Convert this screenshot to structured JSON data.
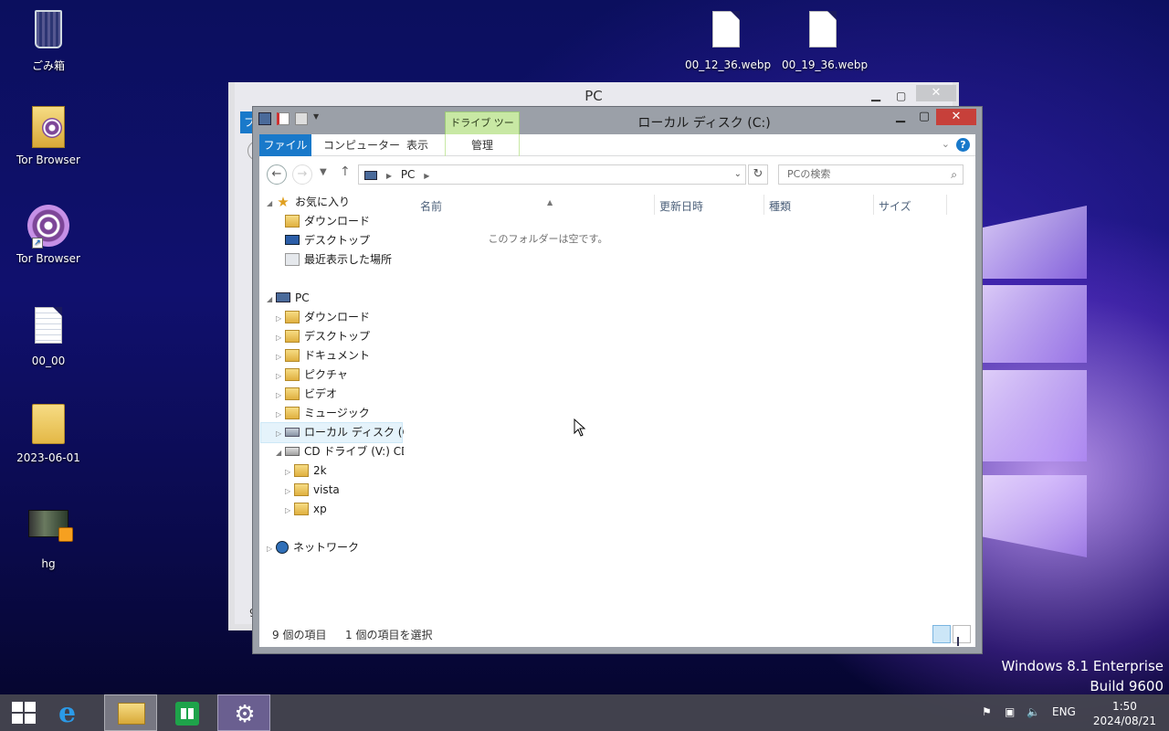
{
  "desktop": {
    "icons": [
      {
        "label": "ごみ箱"
      },
      {
        "label": "Tor Browser"
      },
      {
        "label": "Tor Browser"
      },
      {
        "label": "00_00"
      },
      {
        "label": "2023-06-01"
      },
      {
        "label": "hg"
      },
      {
        "label": "00_12_36.webp"
      },
      {
        "label": "00_19_36.webp"
      }
    ]
  },
  "bg_window": {
    "title": "PC",
    "partial_tab": "フ",
    "partial_status": "9"
  },
  "window": {
    "title": "ローカル ディスク (C:)",
    "tool_tab": "ドライブ ツール",
    "ribbon_tabs": {
      "file": "ファイル",
      "computer": "コンピューター",
      "view": "表示",
      "manage": "管理"
    },
    "address": {
      "crumb": "PC",
      "search_placeholder": "PCの検索"
    },
    "nav": {
      "favorites": "お気に入り",
      "fav_downloads": "ダウンロード",
      "fav_desktop": "デスクトップ",
      "fav_recent": "最近表示した場所",
      "pc": "PC",
      "pc_downloads": "ダウンロード",
      "pc_desktop": "デスクトップ",
      "pc_documents": "ドキュメント",
      "pc_pictures": "ピクチャ",
      "pc_videos": "ビデオ",
      "pc_music": "ミュージック",
      "local_disk": "ローカル ディスク (C:)",
      "cd_drive": "CD ドライブ (V:) CDF",
      "cd_2k": "2k",
      "cd_vista": "vista",
      "cd_xp": "xp",
      "network": "ネットワーク"
    },
    "columns": {
      "name": "名前",
      "modified": "更新日時",
      "type": "種類",
      "size": "サイズ"
    },
    "empty_message": "このフォルダーは空です。",
    "status": {
      "item_count": "9 個の項目",
      "selected": "1 個の項目を選択"
    }
  },
  "watermark": {
    "line1": "Windows 8.1 Enterprise",
    "line2": "Build 9600"
  },
  "taskbar": {
    "lang": "ENG",
    "time": "1:50",
    "date": "2024/08/21"
  },
  "colors": {
    "ribbon_file_tab": "#1979ca",
    "tool_tab": "#c8e8a4",
    "close_button": "#c7403a"
  }
}
